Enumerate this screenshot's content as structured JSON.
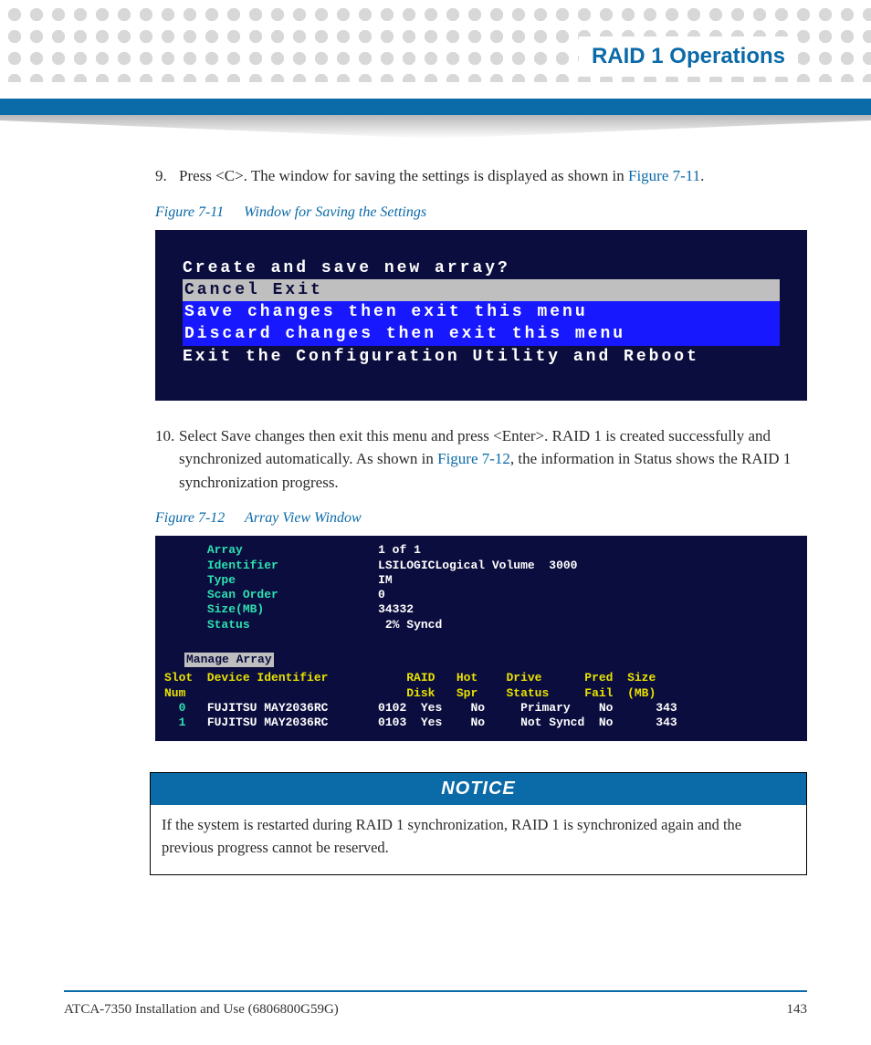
{
  "header": {
    "title": "RAID 1 Operations"
  },
  "steps": {
    "s9": {
      "num": "9.",
      "text_a": "Press <C>. The window for saving the settings is displayed as shown in ",
      "link": "Figure 7-11",
      "text_b": "."
    },
    "s10": {
      "num": "10.",
      "text_a": "Select Save changes then exit this menu and press <Enter>. RAID 1 is created successfully and synchronized automatically. As shown in ",
      "link": "Figure 7-12",
      "text_b": ", the information in Status shows the RAID 1 synchronization progress."
    }
  },
  "fig11": {
    "label": "Figure 7-11",
    "title": "Window for Saving the Settings",
    "lines": {
      "prompt": "Create and save new array?",
      "cancel": "Cancel Exit",
      "save": "Save changes then exit this menu",
      "discard": "Discard changes then exit this menu",
      "exit": "Exit the Configuration Utility and Reboot"
    }
  },
  "fig12": {
    "label": "Figure 7-12",
    "title": "Array View Window",
    "info": {
      "array_l": "Array",
      "array_v": "1 of 1",
      "ident_l": "Identifier",
      "ident_v": "LSILOGICLogical Volume  3000",
      "type_l": "Type",
      "type_v": "IM",
      "scan_l": "Scan Order",
      "scan_v": "0",
      "size_l": "Size(MB)",
      "size_v": "34332",
      "status_l": "Status",
      "status_v": " 2% Syncd"
    },
    "manage": "Manage Array",
    "headers": {
      "l1": "Slot  Device Identifier           RAID   Hot    Drive      Pred  Size",
      "l2": "Num                               Disk   Spr    Status     Fail  (MB)"
    },
    "rows": {
      "r0_slot": "  0   ",
      "r0_dev": "FUJITSU MAY2036RC       0102  Yes    No     Primary    No      343",
      "r1_slot": "  1   ",
      "r1_dev": "FUJITSU MAY2036RC       0103  Yes    No     Not Syncd  No      343"
    }
  },
  "notice": {
    "head": "NOTICE",
    "body": "If the system is restarted during RAID 1 synchronization, RAID 1 is synchronized again and the previous progress cannot be reserved."
  },
  "footer": {
    "left": "ATCA-7350 Installation and Use (6806800G59G)",
    "page": "143"
  }
}
